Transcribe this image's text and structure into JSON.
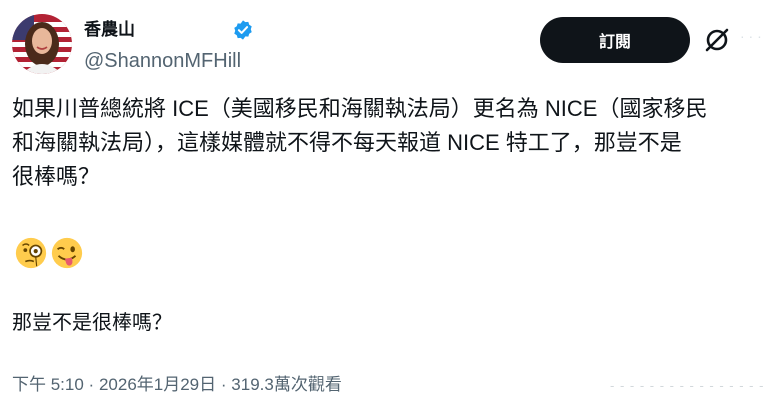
{
  "author": {
    "display_name": "香農山",
    "handle": "@ShannonMFHill",
    "verified": true
  },
  "actions": {
    "subscribe_label": "訂閱",
    "brand_icon": "x-logo-icon"
  },
  "tweet": {
    "text_lines": [
      "如果川普總統將 ICE（美國移民和海關執法局）更名為 NICE（國家移民",
      "和海關執法局），這樣媒體就不得不每天報道 NICE 特工了，那豈不是",
      "很棒嗎？"
    ],
    "emojis": [
      "face-with-monocle",
      "winking-face-with-tongue"
    ],
    "second_text": "那豈不是很棒嗎？"
  },
  "meta": {
    "time": "下午 5:10",
    "separator": "·",
    "date": "2026年1月29日",
    "views": "319.3萬次觀看"
  },
  "colors": {
    "text": "#0f1419",
    "secondary": "#536471",
    "verified_blue": "#1d9bf0",
    "button_bg": "#0f1419"
  }
}
